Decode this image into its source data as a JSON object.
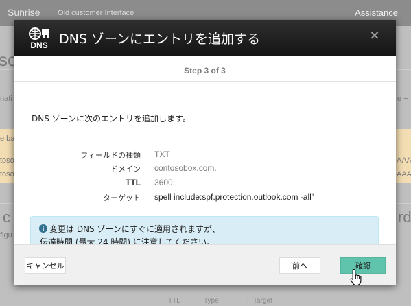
{
  "background": {
    "app_name": "Sunrise",
    "old_interface_link": "Old customer Interface",
    "assistance": "Assistance",
    "fragments": {
      "left_heading": "so",
      "left_subtext": "nati",
      "right_subtext": "e +",
      "strip_left_1": "e ba",
      "strip_left_2": "toso",
      "strip_left_3": "toso",
      "strip_right_1": "AAA",
      "strip_right_2": "AAA",
      "left_heading_2": "c",
      "left_subtext_2": "figu",
      "right_heading_2": "rd"
    },
    "table_headers": [
      "TTL",
      "Type",
      "Target"
    ]
  },
  "modal": {
    "title": "DNS ゾーンにエントリを追加する",
    "close_label": "×",
    "step": "Step 3 of 3",
    "intro": "DNS ゾーンに次のエントリを追加します。",
    "record": {
      "type_label": "フィールドの種類",
      "type_value": "TXT",
      "domain_label": "ドメイン",
      "domain_value": "contosobox.com.",
      "ttl_label": "TTL",
      "ttl_value": "3600",
      "target_label": "ターゲット",
      "target_value": "spell include:spf.protection.outlook.com -all\""
    },
    "info": {
      "icon": "i",
      "line1": "変更は DNS ゾーンにすぐに適用されますが、",
      "line2": "伝達時間 (最大 24 時間) に注意してください。"
    },
    "buttons": {
      "cancel": "キャンセル",
      "previous": "前へ",
      "confirm": "確認"
    }
  },
  "colors": {
    "header_dark": "#1f1f1f",
    "confirm_green": "#60c4ad",
    "info_bg": "#d9edf7"
  }
}
